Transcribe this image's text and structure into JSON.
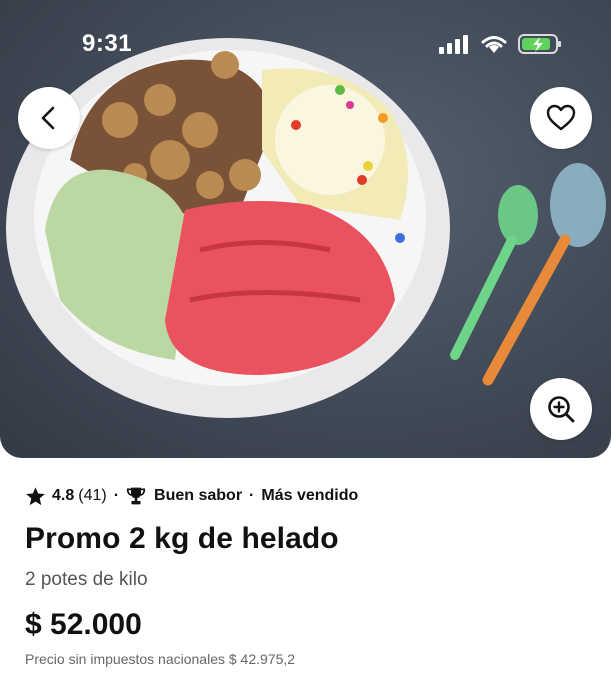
{
  "status_bar": {
    "time": "9:31"
  },
  "hero": {
    "image_alt": "Helado tricolor con nueces y confites",
    "icons": {
      "back": "chevron-left-icon",
      "favorite": "heart-icon",
      "zoom": "zoom-in-icon"
    }
  },
  "product": {
    "rating": "4.8",
    "rating_count": "(41)",
    "badge_1": "Buen sabor",
    "badge_2": "Más vendido",
    "separator": "·",
    "title": "Promo 2 kg de helado",
    "subtitle": "2 potes de kilo",
    "price": "$ 52.000",
    "tax_note": "Precio sin impuestos nacionales $ 42.975,2"
  },
  "colors": {
    "text": "#111111",
    "muted": "#555555",
    "background": "#ffffff"
  }
}
